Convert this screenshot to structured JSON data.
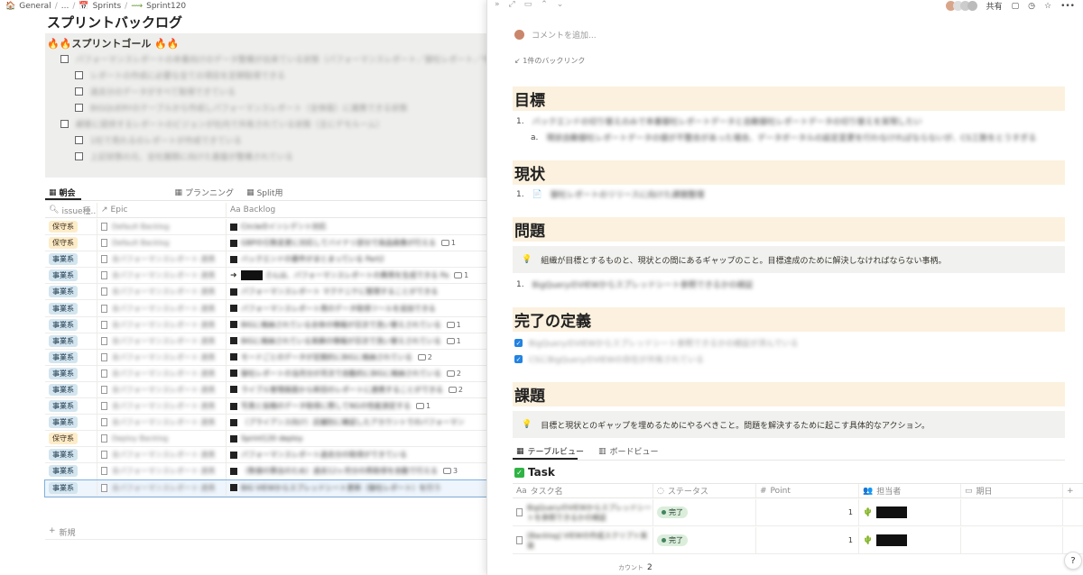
{
  "breadcrumb": {
    "workspace": "General",
    "ellipsis": "...",
    "sprints": "Sprints",
    "sprint": "Sprint120"
  },
  "page": {
    "title": "スプリントバックログ",
    "goal_title": "🔥🔥スプリントゴール 🔥🔥"
  },
  "goals": [
    {
      "text": "パフォーマンスレポートの本番向けのデータ整備が出来ている状態（パフォーマンスレポート／御社レポート／サ",
      "level": 0
    },
    {
      "text": "レポートの作成に必要な全ての項目を定期取得できる",
      "level": 1
    },
    {
      "text": "過去分のデータがすべて取得できている",
      "level": 1
    },
    {
      "text": "BIGQUERYのテーブルから作成しパフォーマンスレポート（全体版）に連携できる状態",
      "level": 1
    },
    {
      "text": "顧客に提供するレポートのビジョンが社内で共有されている状態（主にデモルーム）",
      "level": 0
    },
    {
      "text": "1社で見れるのレポートが作成できている",
      "level": 1
    },
    {
      "text": "上記状態の元、全社展開に向けた基盤が整備されている",
      "level": 1
    }
  ],
  "left_tabs": {
    "tab1": "朝会",
    "tab2": "プランニング",
    "tab3": "Split用"
  },
  "left_table": {
    "columns": {
      "c1": "issue種...",
      "c2": "Epic",
      "c3": "Backlog"
    },
    "rows": [
      {
        "tag": "保守系",
        "kind": "hoshu",
        "epic": "Default Backlog",
        "backlog": "Circleのインシデント対応",
        "comments": ""
      },
      {
        "tag": "保守系",
        "kind": "hoshu",
        "epic": "Default Backlog",
        "backlog": "GBPの引数変更に対応してバイナリ部分で商品画像が行える",
        "comments": "1"
      },
      {
        "tag": "事業系",
        "kind": "jigyou",
        "epic": "全パフォーマンスレポート 連携",
        "backlog": "バックエンドの要件がまとまっている Part2",
        "comments": ""
      },
      {
        "tag": "事業系",
        "kind": "jigyou",
        "epic": "全パフォーマンスレポート 連携",
        "backlog": "さんは、パフォーマンスレポートの費用を生成できる Pa",
        "comments": "1"
      },
      {
        "tag": "事業系",
        "kind": "jigyou",
        "epic": "全パフォーマンスレポート 連携",
        "backlog": "パフォーマンスレポート マクナニケに整理することができる",
        "comments": ""
      },
      {
        "tag": "事業系",
        "kind": "jigyou",
        "epic": "全パフォーマンスレポート 連携",
        "backlog": "パフォーマンスレポート用のデータ取得ツールを追加できる",
        "comments": ""
      },
      {
        "tag": "事業系",
        "kind": "jigyou",
        "epic": "全パフォーマンスレポート 連携",
        "backlog": "BIGに格納されている全体の情報が日次で洗い替えされている",
        "comments": "1"
      },
      {
        "tag": "事業系",
        "kind": "jigyou",
        "epic": "全パフォーマンスレポート 連携",
        "backlog": "BIGに格納されている実績の情報が日次で洗い替えされている",
        "comments": "1"
      },
      {
        "tag": "事業系",
        "kind": "jigyou",
        "epic": "全パフォーマンスレポート 連携",
        "backlog": "モードごとのデータが定期的にBIGに格納されている",
        "comments": "2"
      },
      {
        "tag": "事業系",
        "kind": "jigyou",
        "epic": "全パフォーマンスレポート 連携",
        "backlog": "御社レポートの当月分が月次で自動的にBIGに格納されている",
        "comments": "2"
      },
      {
        "tag": "事業系",
        "kind": "jigyou",
        "epic": "全パフォーマンスレポート 連携",
        "backlog": "ライブル管理画面から新旧のレポートに連携することができる",
        "comments": "2"
      },
      {
        "tag": "事業系",
        "kind": "jigyou",
        "epic": "全パフォーマンスレポート 連携",
        "backlog": "写真と投稿のデータ取得に際してNGの性能測定する",
        "comments": "1"
      },
      {
        "tag": "事業系",
        "kind": "jigyou",
        "epic": "全パフォーマンスレポート 連携",
        "backlog": "（プライアンス向け）店舗別に確認したアカウントでのパフォーマン",
        "comments": ""
      },
      {
        "tag": "保守系",
        "kind": "hoshu",
        "epic": "Deploy Backlog",
        "backlog": "Sprint120 deploy",
        "comments": ""
      },
      {
        "tag": "事業系",
        "kind": "jigyou",
        "epic": "全パフォーマンスレポート 連携",
        "backlog": "パフォーマンスレポート過去分の取得ができている",
        "comments": ""
      },
      {
        "tag": "事業系",
        "kind": "jigyou",
        "epic": "全パフォーマンスレポート 連携",
        "backlog": "（数値の算出のため）過去12ヶ月分の再取得を自動で行える",
        "comments": "3"
      },
      {
        "tag": "事業系",
        "kind": "jigyou",
        "epic": "全パフォーマンスレポート 連携",
        "backlog": "BIG VIEWからスプレッドシート更新（御社レポート）を行う",
        "comments": ""
      }
    ],
    "new_label": "新規"
  },
  "right": {
    "share_label": "共有",
    "comment_placeholder": "コメントを追加...",
    "backlink": "1件のバックリンク",
    "h_goal": "目標",
    "goal_item_1": "バックエンドの切り替えのみで本番御社レポートデータと自動御社レポートデータの切り替えを実現したい",
    "goal_item_1a": "現状自動御社レポートデータの値が不整合があった場合、データボータルの設定変更を行わなければならないが、CS工数をとうすぎる",
    "h_status": "現状",
    "status_item_1": "御社レポートのリリースに向けた課題整理",
    "h_problem": "問題",
    "problem_callout": "組織が目標とするものと、現状との間にあるギャップのこと。目標達成のために解決しなければならない事柄。",
    "problem_item_1": "BigQueryのVIEWからスプレッドシート参照できるかの検証",
    "h_done": "完了の定義",
    "done_item_1": "BigQueryのVIEWからスプレッドシート参照できるかの検証が済んでいる",
    "done_item_2": "CSにBigQueryのVIEWの存在が共有されている",
    "h_issue": "課題",
    "issue_callout": "目標と現状とのギャップを埋めるためにやるべきこと。問題を解決するために起こす具体的なアクション。",
    "tab_table": "テーブルビュー",
    "tab_board": "ボードビュー",
    "task_title": "Task",
    "task_columns": {
      "name": "タスク名",
      "status": "ステータス",
      "point": "Point",
      "assignee": "担当者",
      "due": "期日"
    },
    "tasks": [
      {
        "name": "BigQueryのVIEWからスプレッドシートを参照できるかの検証",
        "status": "完了",
        "point": "1"
      },
      {
        "name": "[Backlog] VIEWの作成スクリプト実装",
        "status": "完了",
        "point": "1"
      }
    ],
    "count_label": "カウント",
    "count_value": "2",
    "help": "?"
  },
  "colors": {
    "accent": "#2383e2",
    "heading_bg": "#fbf1de",
    "callout_bg": "#f1f1ef",
    "tag_jigyou": "#d3e5ef",
    "tag_hoshu": "#fdecc8",
    "status_done": "#dbeddb"
  }
}
